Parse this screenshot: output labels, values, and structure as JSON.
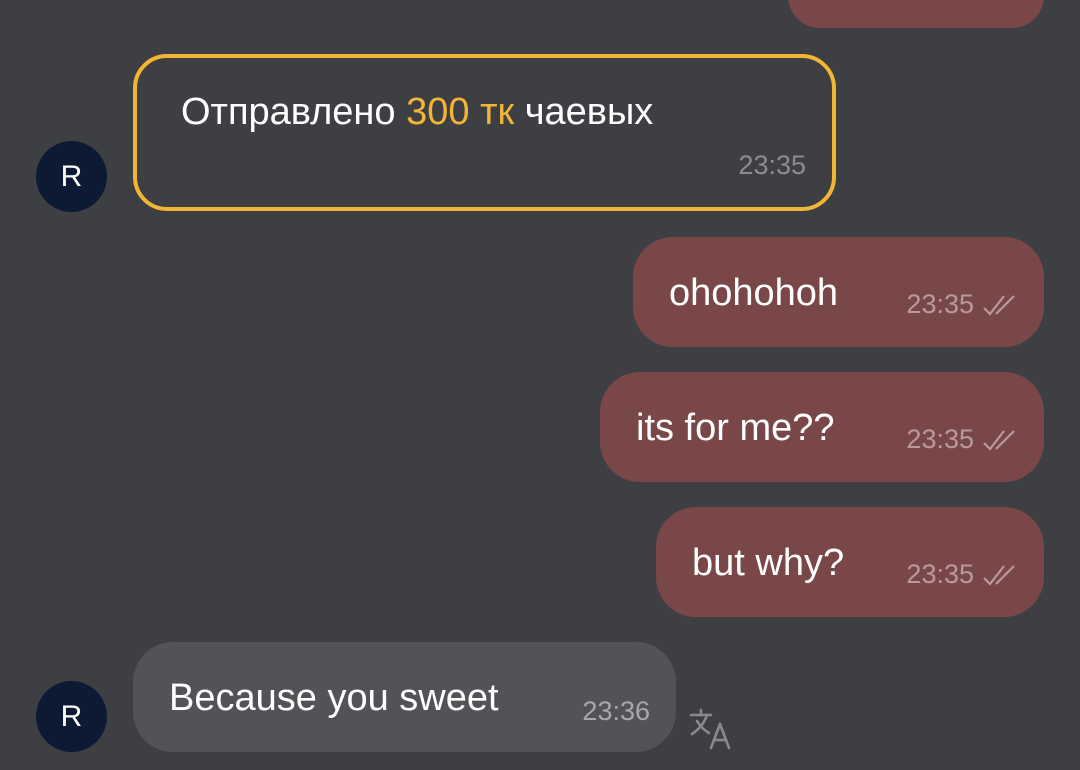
{
  "colors": {
    "background": "#3e3f43",
    "outgoing_bubble": "#7a4749",
    "incoming_bubble": "#535357",
    "tip_accent": "#f2b535",
    "avatar_bg": "#0c1a33"
  },
  "tip_message": {
    "prefix": "Отправлено",
    "amount": "300 тк",
    "suffix": "чаевых",
    "time": "23:35"
  },
  "avatars": [
    {
      "letter": "R"
    },
    {
      "letter": "R"
    }
  ],
  "outgoing_messages": [
    {
      "text": "ohohohoh",
      "time": "23:35",
      "status_icon": "double-check-icon"
    },
    {
      "text": "its for me??",
      "time": "23:35",
      "status_icon": "double-check-icon"
    },
    {
      "text": "but why?",
      "time": "23:35",
      "status_icon": "double-check-icon"
    }
  ],
  "incoming_message": {
    "text": "Because you sweet",
    "time": "23:36"
  },
  "icons": {
    "translate": "translate-icon"
  }
}
